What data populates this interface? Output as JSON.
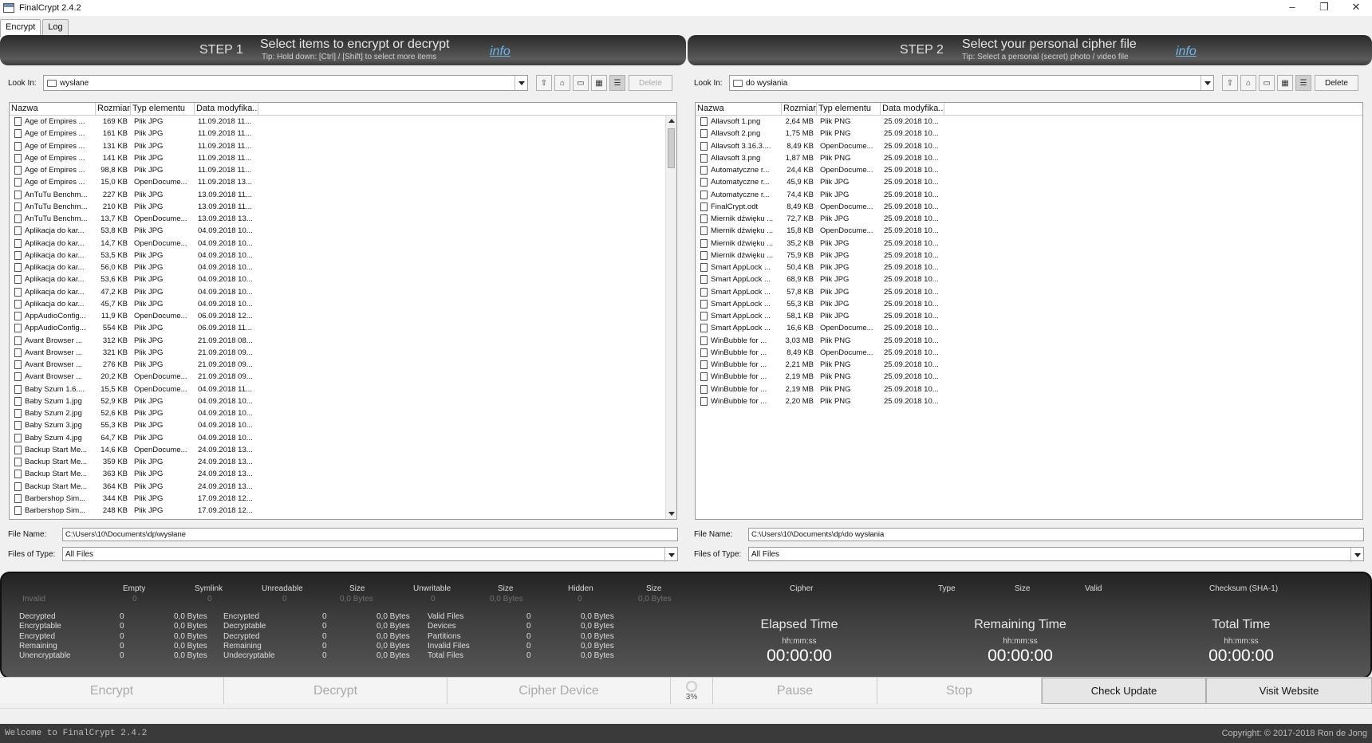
{
  "window": {
    "title": "FinalCrypt 2.4.2",
    "min": "–",
    "max": "❐",
    "close": "✕"
  },
  "tabs": [
    {
      "label": "Encrypt"
    },
    {
      "label": "Log"
    }
  ],
  "step1": {
    "num": "STEP 1",
    "title": "Select items to encrypt or decrypt",
    "tip": "Tip: Hold down: [Ctrl] / [Shift] to select more items",
    "info": "info"
  },
  "step2": {
    "num": "STEP 2",
    "title": "Select your personal cipher file",
    "tip": "Tip: Select a personal (secret) photo / video file",
    "info": "info"
  },
  "left": {
    "look_in_label": "Look In:",
    "look_in_value": "wysłane",
    "delete": "Delete",
    "columns": [
      "Nazwa",
      "Rozmiar",
      "Typ elementu",
      "Data modyfika..."
    ],
    "file_name_label": "File Name:",
    "file_name": "C:\\Users\\10\\Documents\\dp\\wysłane",
    "files_of_type_label": "Files of Type:",
    "files_of_type": "All Files",
    "rows": [
      [
        "Age of Empires ...",
        "169 KB",
        "Plik JPG",
        "11.09.2018 11..."
      ],
      [
        "Age of Empires ...",
        "161 KB",
        "Plik JPG",
        "11.09.2018 11..."
      ],
      [
        "Age of Empires ...",
        "131 KB",
        "Plik JPG",
        "11.09.2018 11..."
      ],
      [
        "Age of Empires ...",
        "141 KB",
        "Plik JPG",
        "11.09.2018 11..."
      ],
      [
        "Age of Empires ...",
        "98,8 KB",
        "Plik JPG",
        "11.09.2018 11..."
      ],
      [
        "Age of Empires ...",
        "15,0 KB",
        "OpenDocume...",
        "11.09.2018 13..."
      ],
      [
        "AnTuTu Benchm...",
        "227 KB",
        "Plik JPG",
        "13.09.2018 11..."
      ],
      [
        "AnTuTu Benchm...",
        "210 KB",
        "Plik JPG",
        "13.09.2018 11..."
      ],
      [
        "AnTuTu Benchm...",
        "13,7 KB",
        "OpenDocume...",
        "13.09.2018 13..."
      ],
      [
        "Aplikacja do kar...",
        "53,8 KB",
        "Plik JPG",
        "04.09.2018 10..."
      ],
      [
        "Aplikacja do kar...",
        "14,7 KB",
        "OpenDocume...",
        "04.09.2018 10..."
      ],
      [
        "Aplikacja do kar...",
        "53,5 KB",
        "Plik JPG",
        "04.09.2018 10..."
      ],
      [
        "Aplikacja do kar...",
        "56,0 KB",
        "Plik JPG",
        "04.09.2018 10..."
      ],
      [
        "Aplikacja do kar...",
        "53,6 KB",
        "Plik JPG",
        "04.09.2018 10..."
      ],
      [
        "Aplikacja do kar...",
        "47,2 KB",
        "Plik JPG",
        "04.09.2018 10..."
      ],
      [
        "Aplikacja do kar...",
        "45,7 KB",
        "Plik JPG",
        "04.09.2018 10..."
      ],
      [
        "AppAudioConfig...",
        "11,9 KB",
        "OpenDocume...",
        "06.09.2018 12..."
      ],
      [
        "AppAudioConfig...",
        "554 KB",
        "Plik JPG",
        "06.09.2018 11..."
      ],
      [
        "Avant Browser ...",
        "312 KB",
        "Plik JPG",
        "21.09.2018 08..."
      ],
      [
        "Avant Browser ...",
        "321 KB",
        "Plik JPG",
        "21.09.2018 09..."
      ],
      [
        "Avant Browser ...",
        "276 KB",
        "Plik JPG",
        "21.09.2018 09..."
      ],
      [
        "Avant Browser ...",
        "20,2 KB",
        "OpenDocume...",
        "21.09.2018 09..."
      ],
      [
        "Baby Szum 1.6....",
        "15,5 KB",
        "OpenDocume...",
        "04.09.2018 11..."
      ],
      [
        "Baby Szum 1.jpg",
        "52,9 KB",
        "Plik JPG",
        "04.09.2018 10..."
      ],
      [
        "Baby Szum 2.jpg",
        "52,6 KB",
        "Plik JPG",
        "04.09.2018 10..."
      ],
      [
        "Baby Szum 3.jpg",
        "55,3 KB",
        "Plik JPG",
        "04.09.2018 10..."
      ],
      [
        "Baby Szum 4.jpg",
        "64,7 KB",
        "Plik JPG",
        "04.09.2018 10..."
      ],
      [
        "Backup Start Me...",
        "14,6 KB",
        "OpenDocume...",
        "24.09.2018 13..."
      ],
      [
        "Backup Start Me...",
        "359 KB",
        "Plik JPG",
        "24.09.2018 13..."
      ],
      [
        "Backup Start Me...",
        "363 KB",
        "Plik JPG",
        "24.09.2018 13..."
      ],
      [
        "Backup Start Me...",
        "364 KB",
        "Plik JPG",
        "24.09.2018 13..."
      ],
      [
        "Barbershop Sim...",
        "344 KB",
        "Plik JPG",
        "17.09.2018 12..."
      ],
      [
        "Barbershop Sim...",
        "248 KB",
        "Plik JPG",
        "17.09.2018 12..."
      ]
    ]
  },
  "right": {
    "look_in_label": "Look In:",
    "look_in_value": "do wysłania",
    "delete": "Delete",
    "columns": [
      "Nazwa",
      "Rozmiar",
      "Typ elementu",
      "Data modyfika..."
    ],
    "file_name_label": "File Name:",
    "file_name": "C:\\Users\\10\\Documents\\dp\\do wysłania",
    "files_of_type_label": "Files of Type:",
    "files_of_type": "All Files",
    "rows": [
      [
        "Allavsoft 1.png",
        "2,64 MB",
        "Plik PNG",
        "25.09.2018 10..."
      ],
      [
        "Allavsoft 2.png",
        "1,75 MB",
        "Plik PNG",
        "25.09.2018 10..."
      ],
      [
        "Allavsoft 3.16.3....",
        "8,49 KB",
        "OpenDocume...",
        "25.09.2018 10..."
      ],
      [
        "Allavsoft 3.png",
        "1,87 MB",
        "Plik PNG",
        "25.09.2018 10..."
      ],
      [
        "Automatyczne r...",
        "24,4 KB",
        "OpenDocume...",
        "25.09.2018 10..."
      ],
      [
        "Automatyczne r...",
        "45,9 KB",
        "Plik JPG",
        "25.09.2018 10..."
      ],
      [
        "Automatyczne r...",
        "74,4 KB",
        "Plik JPG",
        "25.09.2018 10..."
      ],
      [
        "FinalCrypt.odt",
        "8,49 KB",
        "OpenDocume...",
        "25.09.2018 10..."
      ],
      [
        "Miernik dźwięku ...",
        "72,7 KB",
        "Plik JPG",
        "25.09.2018 10..."
      ],
      [
        "Miernik dźwięku ...",
        "15,8 KB",
        "OpenDocume...",
        "25.09.2018 10..."
      ],
      [
        "Miernik dźwięku ...",
        "35,2 KB",
        "Plik JPG",
        "25.09.2018 10..."
      ],
      [
        "Miernik dźwięku ...",
        "75,9 KB",
        "Plik JPG",
        "25.09.2018 10..."
      ],
      [
        "Smart AppLock ...",
        "50,4 KB",
        "Plik JPG",
        "25.09.2018 10..."
      ],
      [
        "Smart AppLock ...",
        "68,9 KB",
        "Plik JPG",
        "25.09.2018 10..."
      ],
      [
        "Smart AppLock ...",
        "57,8 KB",
        "Plik JPG",
        "25.09.2018 10..."
      ],
      [
        "Smart AppLock ...",
        "55,3 KB",
        "Plik JPG",
        "25.09.2018 10..."
      ],
      [
        "Smart AppLock ...",
        "58,1 KB",
        "Plik JPG",
        "25.09.2018 10..."
      ],
      [
        "Smart AppLock ...",
        "16,6 KB",
        "OpenDocume...",
        "25.09.2018 10..."
      ],
      [
        "WinBubble for ...",
        "3,03 MB",
        "Plik PNG",
        "25.09.2018 10..."
      ],
      [
        "WinBubble for ...",
        "8,49 KB",
        "OpenDocume...",
        "25.09.2018 10..."
      ],
      [
        "WinBubble for ...",
        "2,21 MB",
        "Plik PNG",
        "25.09.2018 10..."
      ],
      [
        "WinBubble for ...",
        "2,19 MB",
        "Plik PNG",
        "25.09.2018 10..."
      ],
      [
        "WinBubble for ...",
        "2,19 MB",
        "Plik PNG",
        "25.09.2018 10..."
      ],
      [
        "WinBubble for ...",
        "2,20 MB",
        "Plik PNG",
        "25.09.2018 10..."
      ]
    ]
  },
  "stats": {
    "headers": [
      "Empty",
      "Symlink",
      "Unreadable",
      "Size",
      "Unwritable",
      "Size",
      "Hidden",
      "Size"
    ],
    "invalid_row": [
      "Invalid",
      "0",
      "0",
      "0",
      "0,0 Bytes",
      "0",
      "0,0 Bytes",
      "0",
      "0,0 Bytes"
    ],
    "colA": [
      [
        "Decrypted",
        "0",
        "0,0 Bytes"
      ],
      [
        "Encryptable",
        "0",
        "0,0 Bytes"
      ],
      [
        "Encrypted",
        "0",
        "0,0 Bytes"
      ],
      [
        "Remaining",
        "0",
        "0,0 Bytes"
      ],
      [
        "Unencryptable",
        "0",
        "0,0 Bytes"
      ]
    ],
    "colB": [
      [
        "Encrypted",
        "0",
        "0,0 Bytes"
      ],
      [
        "Decryptable",
        "0",
        "0,0 Bytes"
      ],
      [
        "Decrypted",
        "0",
        "0,0 Bytes"
      ],
      [
        "Remaining",
        "0",
        "0,0 Bytes"
      ],
      [
        "Undecryptable",
        "0",
        "0,0 Bytes"
      ]
    ],
    "colC": [
      [
        "Valid Files",
        "0",
        "0,0 Bytes"
      ],
      [
        "Devices",
        "0",
        "0,0 Bytes"
      ],
      [
        "Partitions",
        "0",
        "0,0 Bytes"
      ],
      [
        "Invalid Files",
        "0",
        "0,0 Bytes"
      ],
      [
        "Total Files",
        "0",
        "0,0 Bytes"
      ]
    ],
    "cipher_headers": [
      "Cipher",
      "Type",
      "Size",
      "Valid",
      "Checksum (SHA-1)"
    ],
    "times": [
      {
        "label": "Elapsed Time",
        "fmt": "hh:mm:ss",
        "value": "00:00:00"
      },
      {
        "label": "Remaining Time",
        "fmt": "hh:mm:ss",
        "value": "00:00:00"
      },
      {
        "label": "Total Time",
        "fmt": "hh:mm:ss",
        "value": "00:00:00"
      }
    ]
  },
  "actions": {
    "encrypt": "Encrypt",
    "decrypt": "Decrypt",
    "cipher_device": "Cipher Device",
    "percent": "3%",
    "pause": "Pause",
    "stop": "Stop",
    "check_update": "Check Update",
    "visit_website": "Visit Website"
  },
  "status": {
    "message": "Welcome to FinalCrypt 2.4.2",
    "copyright": "Copyright: © 2017-2018 Ron de Jong"
  }
}
